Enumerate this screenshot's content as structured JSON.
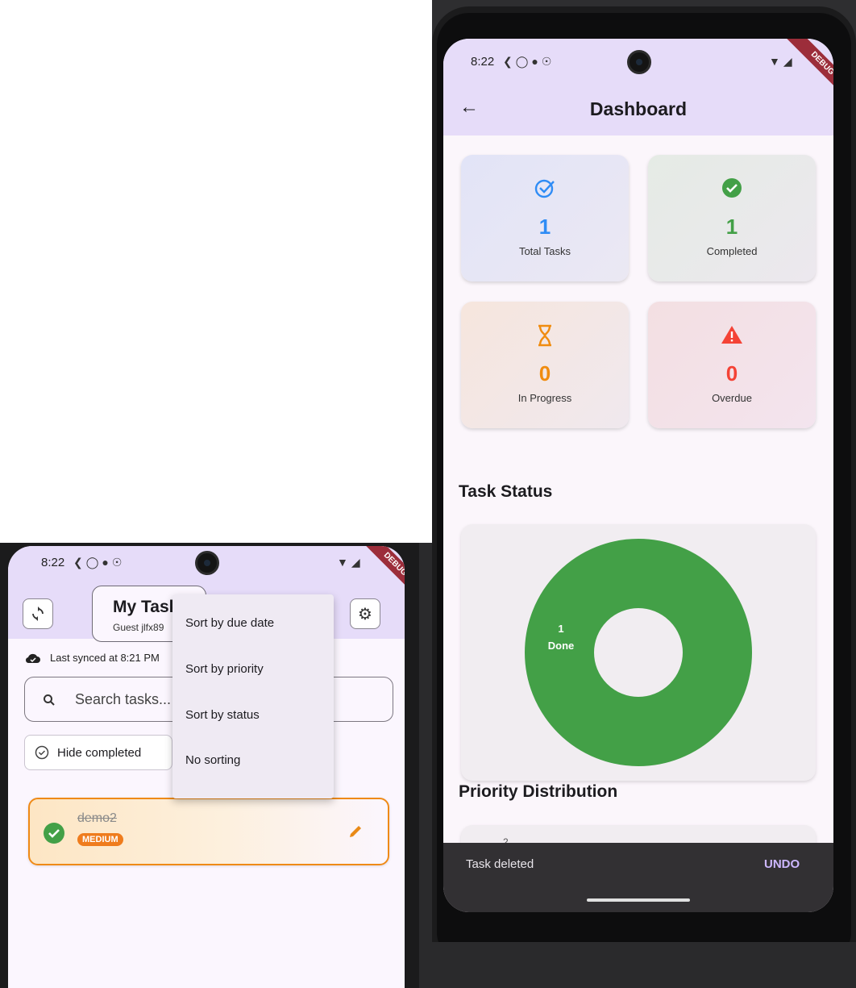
{
  "dashboard": {
    "status_time": "8:22",
    "debug_label": "DEBUG",
    "title": "Dashboard",
    "stats": [
      {
        "value": "1",
        "label": "Total Tasks",
        "icon": "check-circle-outline-icon",
        "color": "#2f8cf5"
      },
      {
        "value": "1",
        "label": "Completed",
        "icon": "check-circle-filled-icon",
        "color": "#43a047"
      },
      {
        "value": "0",
        "label": "In Progress",
        "icon": "hourglass-icon",
        "color": "#f08c10"
      },
      {
        "value": "0",
        "label": "Overdue",
        "icon": "warning-icon",
        "color": "#f44336"
      }
    ],
    "task_status_title": "Task Status",
    "priority_title": "Priority Distribution",
    "priority_axis_label": "2",
    "snackbar": {
      "text": "Task deleted",
      "action": "UNDO"
    },
    "chart_data": {
      "type": "pie",
      "categories": [
        "Done"
      ],
      "values": [
        1
      ],
      "slice_labels": [
        "1\nDone"
      ],
      "colors": [
        "#43a047"
      ],
      "donut": true
    }
  },
  "tasks_screen": {
    "status_time": "8:22",
    "debug_label": "DEBUG",
    "title": "My Task",
    "subtitle": "Guest jlfx89",
    "sync_text": "Last synced at 8:21 PM",
    "search_placeholder": "Search tasks...",
    "hide_completed_label": "Hide completed",
    "sort_menu": [
      "Sort by due date",
      "Sort by priority",
      "Sort by status",
      "No sorting"
    ],
    "tasks": [
      {
        "title": "demo2",
        "priority": "MEDIUM",
        "completed": true
      }
    ]
  }
}
